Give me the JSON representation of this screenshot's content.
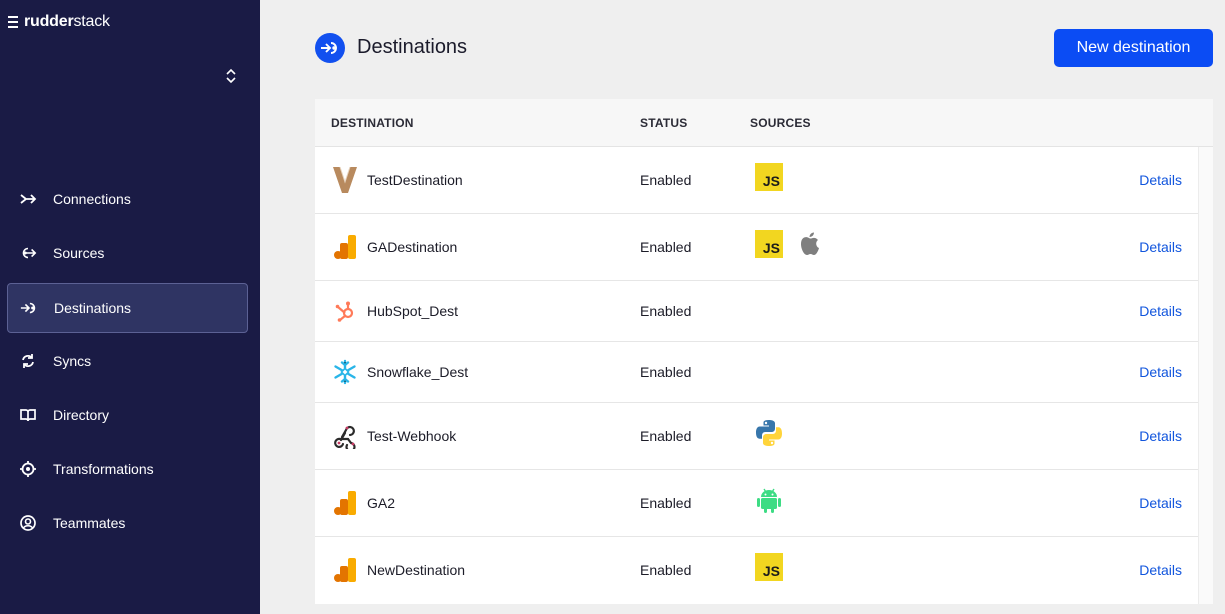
{
  "brand": {
    "name_bold": "rudder",
    "name_light": "stack"
  },
  "nav": [
    {
      "label": "Connections",
      "icon": "connections-icon"
    },
    {
      "label": "Sources",
      "icon": "sources-icon"
    },
    {
      "label": "Destinations",
      "icon": "destinations-icon",
      "active": true
    },
    {
      "label": "Syncs",
      "icon": "syncs-icon"
    },
    {
      "label": "Directory",
      "icon": "directory-icon"
    },
    {
      "label": "Transformations",
      "icon": "transformations-icon"
    },
    {
      "label": "Teammates",
      "icon": "teammates-icon"
    }
  ],
  "header": {
    "title": "Destinations",
    "new_button": "New destination"
  },
  "table": {
    "columns": {
      "destination": "DESTINATION",
      "status": "STATUS",
      "sources": "SOURCES"
    },
    "rows": [
      {
        "name": "TestDestination",
        "icon": "vercel-v-icon",
        "status": "Enabled",
        "sources": [
          "js"
        ],
        "action": "Details"
      },
      {
        "name": "GADestination",
        "icon": "google-analytics-icon",
        "status": "Enabled",
        "sources": [
          "js",
          "apple"
        ],
        "action": "Details"
      },
      {
        "name": "HubSpot_Dest",
        "icon": "hubspot-icon",
        "status": "Enabled",
        "sources": [],
        "action": "Details"
      },
      {
        "name": "Snowflake_Dest",
        "icon": "snowflake-icon",
        "status": "Enabled",
        "sources": [],
        "action": "Details"
      },
      {
        "name": "Test-Webhook",
        "icon": "webhook-icon",
        "status": "Enabled",
        "sources": [
          "python"
        ],
        "action": "Details"
      },
      {
        "name": "GA2",
        "icon": "google-analytics-icon",
        "status": "Enabled",
        "sources": [
          "android"
        ],
        "action": "Details"
      },
      {
        "name": "NewDestination",
        "icon": "google-analytics-icon",
        "status": "Enabled",
        "sources": [
          "js"
        ],
        "action": "Details"
      }
    ]
  },
  "badges": {
    "js": "JS"
  },
  "colors": {
    "sidebar_bg": "#1a1b45",
    "accent": "#0b4cf4",
    "link": "#1155dd"
  }
}
